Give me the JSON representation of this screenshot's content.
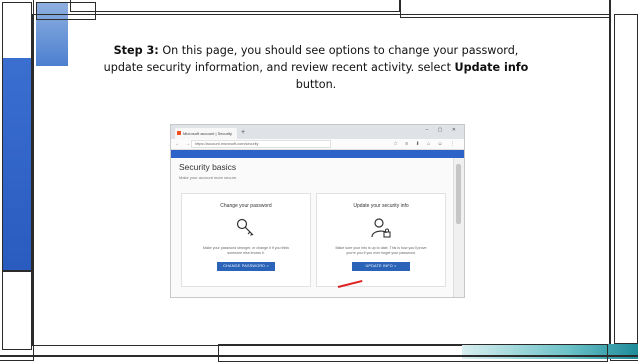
{
  "slide": {
    "step_label": "Step 3:",
    "text_before": " On this page, you should see options to change your password, update security information, and review recent activity. select ",
    "highlight": "Update info",
    "text_after": " button."
  },
  "browser": {
    "tab_title": "Microsoft account | Security",
    "new_tab_symbol": "+",
    "window_controls": "– ▢ ✕",
    "nav_symbols": "← → ⟳ ⌂",
    "url": "https://account.microsoft.com/security",
    "toolbar_symbols": "☆ ≡ ⬇ ⌂ ☺ ⋮"
  },
  "page": {
    "title": "Security basics",
    "subtitle": "Make your account more secure."
  },
  "cards": [
    {
      "title": "Change your password",
      "icon": "key-icon",
      "description": "Make your password stronger, or change it if you think someone else knows it.",
      "button": "CHANGE PASSWORD  >"
    },
    {
      "title": "Update your security info",
      "icon": "user-lock-icon",
      "description": "Make sure your info is up to date. This is how you'll prove you're you if you ever forget your password.",
      "button": "UPDATE INFO  >"
    }
  ],
  "colors": {
    "accent_blue": "#2d63c8",
    "button_blue": "#2a63b8",
    "arrow_red": "#dd2222"
  }
}
